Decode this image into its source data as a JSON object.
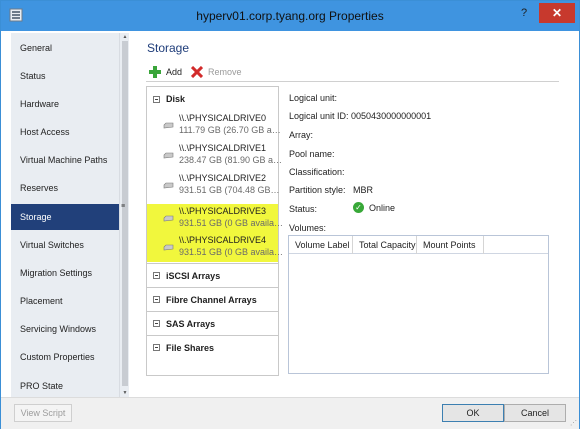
{
  "window": {
    "title": "hyperv01.corp.tyang.org Properties",
    "help": "?",
    "close": "✕"
  },
  "sidebar": {
    "items": [
      {
        "label": "General"
      },
      {
        "label": "Status"
      },
      {
        "label": "Hardware"
      },
      {
        "label": "Host Access"
      },
      {
        "label": "Virtual Machine Paths"
      },
      {
        "label": "Reserves"
      },
      {
        "label": "Storage"
      },
      {
        "label": "Virtual Switches"
      },
      {
        "label": "Migration Settings"
      },
      {
        "label": "Placement"
      },
      {
        "label": "Servicing Windows"
      },
      {
        "label": "Custom Properties"
      },
      {
        "label": "PRO State"
      }
    ],
    "active": "Storage"
  },
  "main": {
    "heading": "Storage",
    "toolbar": {
      "add_label": "Add",
      "remove_label": "Remove"
    },
    "tree": {
      "disk_section": "Disk",
      "drives": [
        {
          "name": "\\\\.\\PHYSICALDRIVE0",
          "info": "111.79 GB (26.70 GB a…",
          "highlighted": false
        },
        {
          "name": "\\\\.\\PHYSICALDRIVE1",
          "info": "238.47 GB (81.90 GB a…",
          "highlighted": false
        },
        {
          "name": "\\\\.\\PHYSICALDRIVE2",
          "info": "931.51 GB (704.48 GB…",
          "highlighted": false
        },
        {
          "name": "\\\\.\\PHYSICALDRIVE3",
          "info": "931.51 GB (0 GB availa…",
          "highlighted": true
        },
        {
          "name": "\\\\.\\PHYSICALDRIVE4",
          "info": "931.51 GB (0 GB availa…",
          "highlighted": true
        }
      ],
      "sections": [
        "iSCSI Arrays",
        "Fibre Channel Arrays",
        "SAS Arrays",
        "File Shares"
      ]
    },
    "details": {
      "logical_unit": "Logical unit:",
      "logical_unit_id": "Logical unit ID: 0050430000000001",
      "array": "Array:",
      "pool_name": "Pool name:",
      "classification": "Classification:",
      "partition_style_label": "Partition style:",
      "partition_style_value": "MBR",
      "status_label": "Status:",
      "status_value": "Online",
      "volumes_label": "Volumes:",
      "volume_columns": [
        "Volume Label",
        "Total Capacity",
        "Mount Points"
      ]
    }
  },
  "footer": {
    "view_script": "View Script",
    "ok": "OK",
    "cancel": "Cancel"
  },
  "colors": {
    "titlebar": "#3f94e0",
    "active_nav": "#21407a",
    "highlight": "#f1f73d",
    "close": "#c7392d",
    "online": "#38a838"
  }
}
